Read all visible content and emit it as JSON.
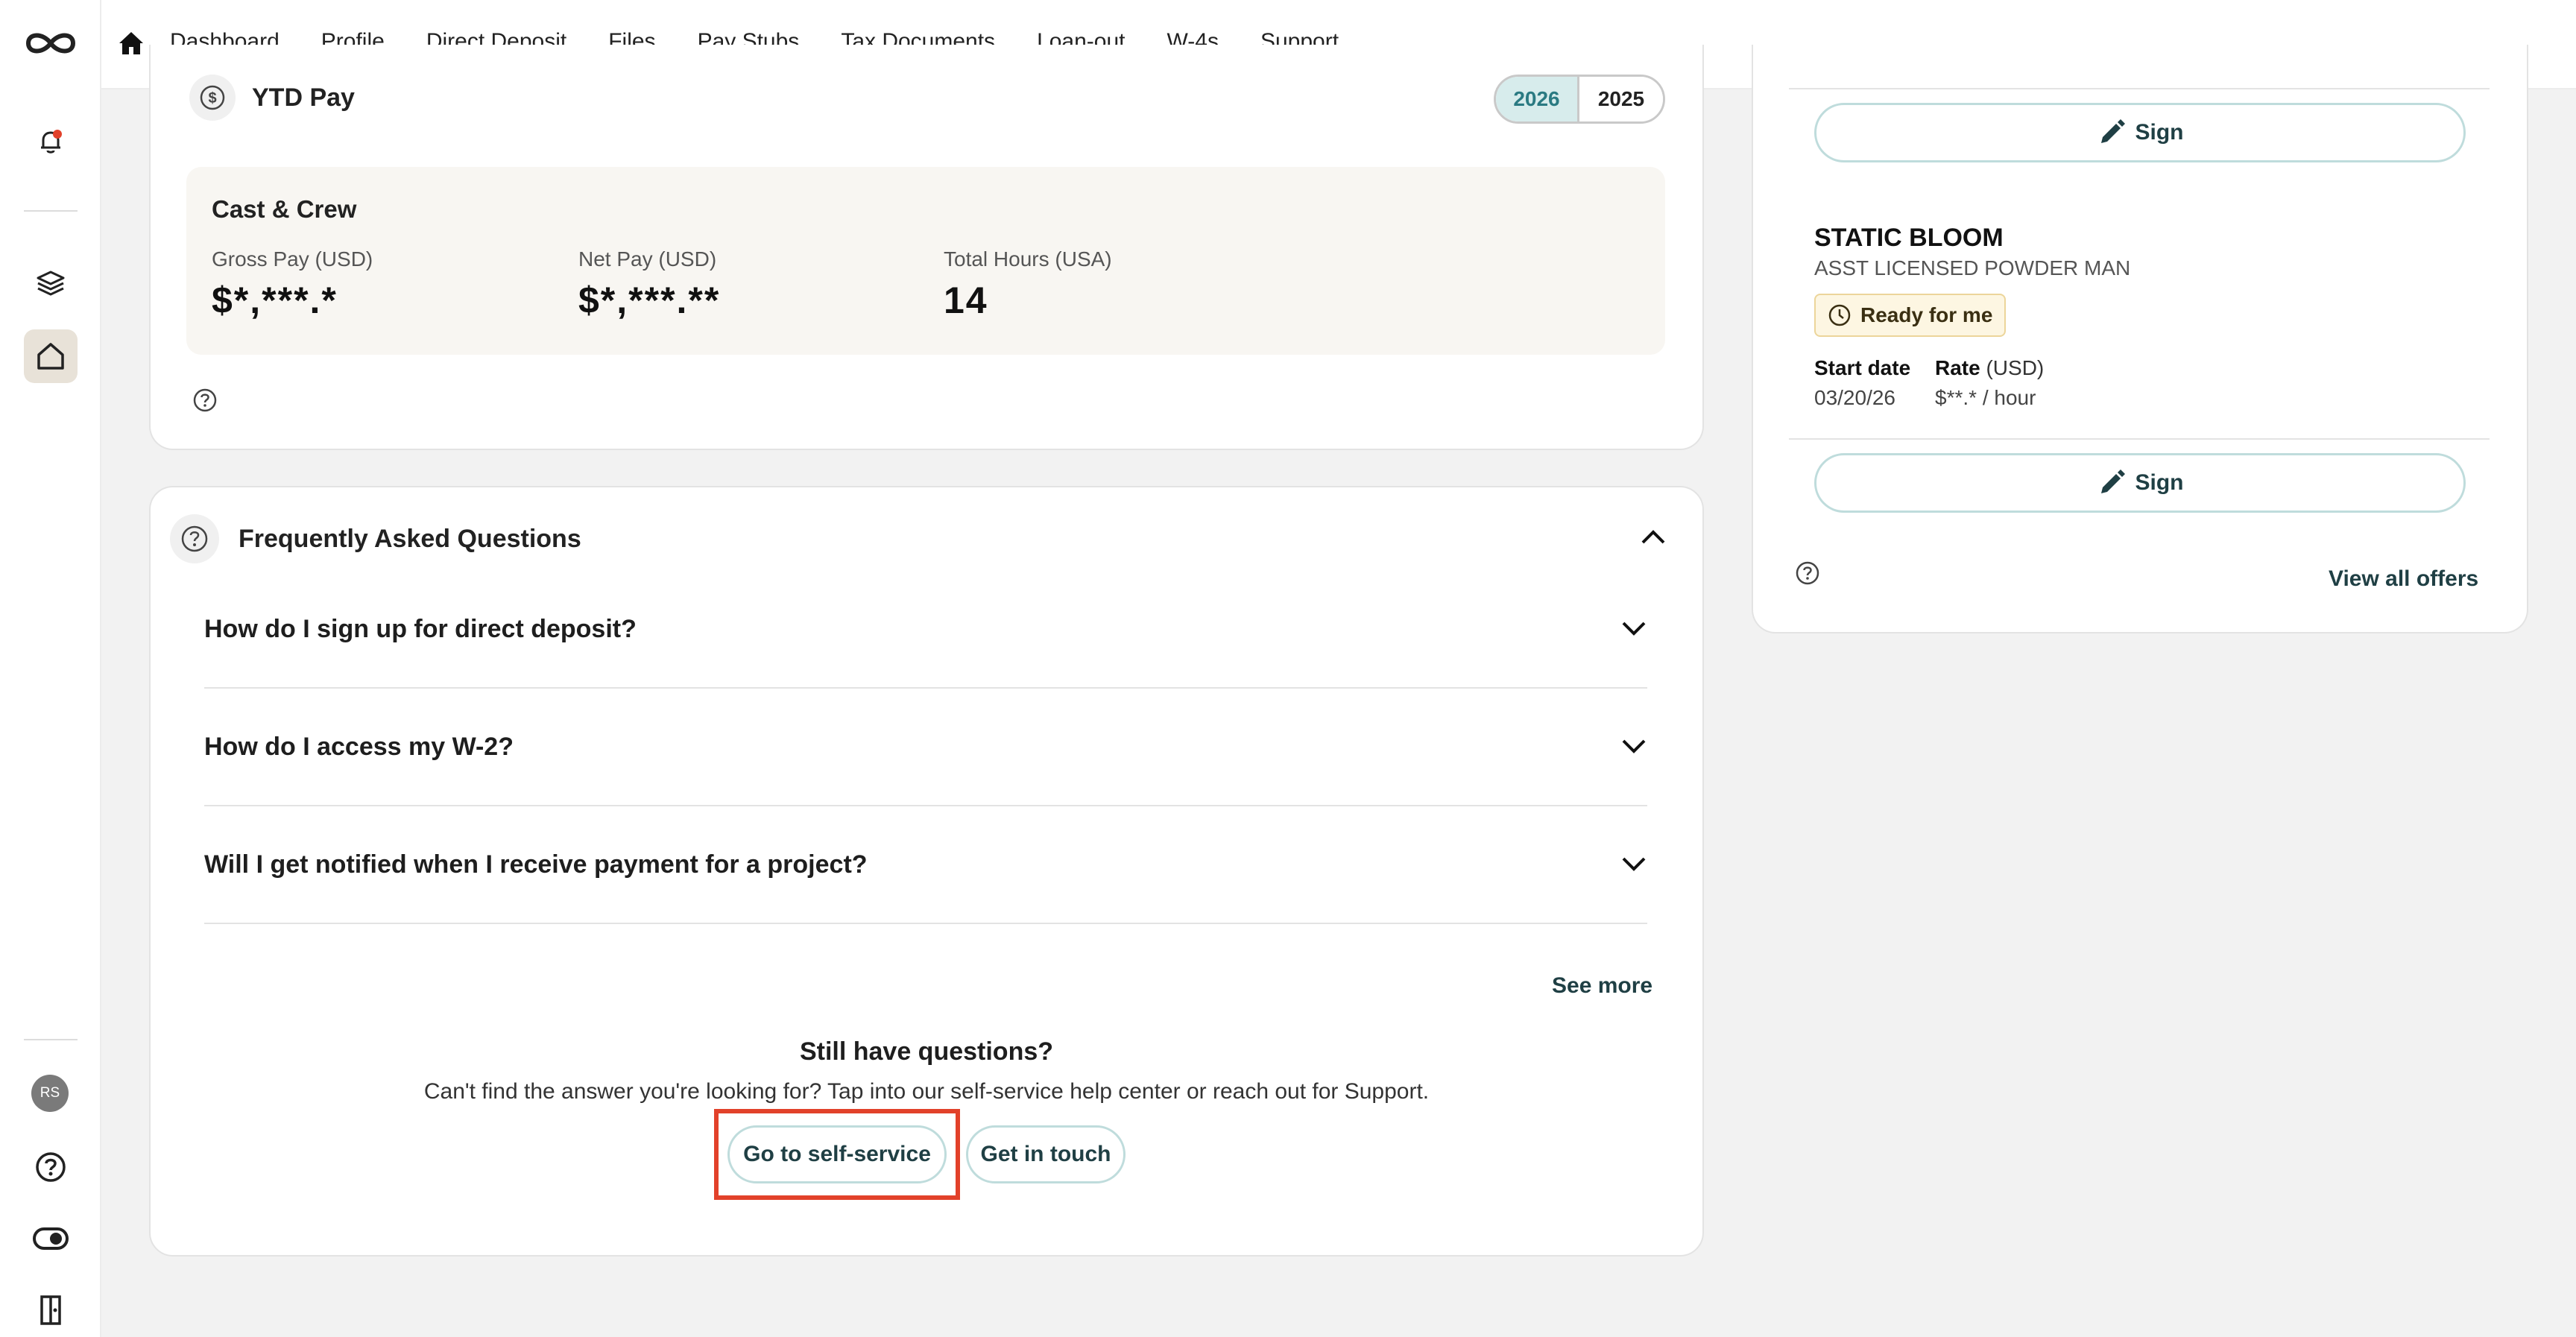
{
  "nav": {
    "items": [
      "Dashboard",
      "Profile",
      "Direct Deposit",
      "Files",
      "Pay Stubs",
      "Tax Documents",
      "Loan-out",
      "W-4s",
      "Support"
    ]
  },
  "rail": {
    "avatar_initials": "RS",
    "icons": [
      "logo-icon",
      "bell-icon",
      "layers-icon",
      "home-icon",
      "help-icon",
      "toggle-icon",
      "exit-door-icon"
    ],
    "notification_dot_color": "#e2412a"
  },
  "ytd": {
    "title": "YTD Pay",
    "years": [
      "2026",
      "2025"
    ],
    "selected_year": "2026",
    "summary": {
      "company": "Cast & Crew",
      "gross_label": "Gross Pay (USD)",
      "gross_value": "$*,***.*",
      "net_label": "Net Pay (USD)",
      "net_value": "$*,***.**",
      "hours_label": "Total Hours (USA)",
      "hours_value": "14"
    }
  },
  "faq": {
    "title": "Frequently Asked Questions",
    "questions": [
      "How do I sign up for direct deposit?",
      "How do I access my W-2?",
      "Will I get notified when I receive payment for a project?"
    ],
    "see_more": "See more",
    "still_title": "Still have questions?",
    "still_sub": "Can't find the answer you're looking for? Tap into our self-service help center or reach out for Support.",
    "self_service": "Go to self-service",
    "get_in_touch": "Get in touch"
  },
  "offers": {
    "sign_label": "Sign",
    "offer": {
      "project": "STATIC BLOOM",
      "role": "ASST LICENSED POWDER MAN",
      "status": "Ready for me",
      "start_label": "Start date",
      "start_value": "03/20/26",
      "rate_label": "Rate",
      "rate_unit": "(USD)",
      "rate_value": "$**.* / hour"
    },
    "view_all": "View all offers"
  },
  "colors": {
    "accent_teal": "#2a7a82",
    "highlight_red": "#e2412a",
    "badge_bg": "#fdf6e2"
  }
}
